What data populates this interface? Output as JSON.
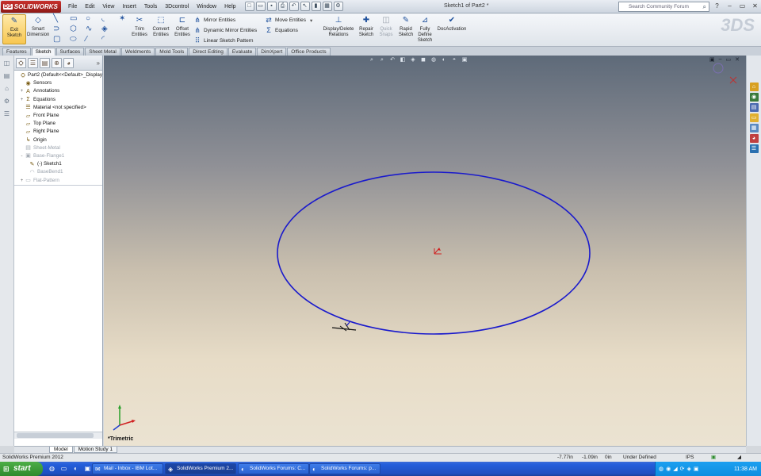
{
  "app": {
    "logo_text": "SOLIDWORKS",
    "logo_mark": "DS",
    "menus": [
      "File",
      "Edit",
      "View",
      "Insert",
      "Tools",
      "3Dcontrol",
      "Window",
      "Help"
    ],
    "window_title": "Sketch1 of Part2 *",
    "search_placeholder": "Search Community Forum"
  },
  "command_manager": {
    "exit_sketch": "Exit Sketch",
    "smart_dimension": "Smart Dimension",
    "trim_entities": "Trim Entities",
    "convert_entities": "Convert Entities",
    "offset_entities": "Offset Entities",
    "mirror_entities": "Mirror Entities",
    "dynamic_mirror": "Dynamic Mirror Entities",
    "linear_pattern": "Linear Sketch Pattern",
    "move_entities": "Move Entities",
    "equations": "Equations",
    "display_delete_relations": "Display/Delete Relations",
    "repair_sketch": "Repair Sketch",
    "quick_snaps": "Quick Snaps",
    "rapid_sketch": "Rapid Sketch",
    "fully_define": "Fully Define Sketch",
    "docactivation": "DocActivation",
    "tabs": [
      "Features",
      "Sketch",
      "Surfaces",
      "Sheet Metal",
      "Weldments",
      "Mold Tools",
      "Direct Editing",
      "Evaluate",
      "DimXpert",
      "Office Products"
    ],
    "active_tab": "Sketch"
  },
  "feature_tree": {
    "items": [
      {
        "label": "Part2  (Default<<Default>_Display",
        "exp": "",
        "icon": "⛭",
        "dim": false,
        "indent": 0
      },
      {
        "label": "Sensors",
        "exp": "",
        "icon": "◉",
        "dim": false,
        "indent": 1
      },
      {
        "label": "Annotations",
        "exp": "+",
        "icon": "A",
        "dim": false,
        "indent": 1
      },
      {
        "label": "Equations",
        "exp": "+",
        "icon": "Σ",
        "dim": false,
        "indent": 1
      },
      {
        "label": "Material <not specified>",
        "exp": "",
        "icon": "☰",
        "dim": false,
        "indent": 1
      },
      {
        "label": "Front Plane",
        "exp": "",
        "icon": "▱",
        "dim": false,
        "indent": 1
      },
      {
        "label": "Top Plane",
        "exp": "",
        "icon": "▱",
        "dim": false,
        "indent": 1
      },
      {
        "label": "Right Plane",
        "exp": "",
        "icon": "▱",
        "dim": false,
        "indent": 1
      },
      {
        "label": "Origin",
        "exp": "",
        "icon": "↳",
        "dim": false,
        "indent": 1
      },
      {
        "label": "Sheet-Metal",
        "exp": "",
        "icon": "▤",
        "dim": true,
        "indent": 1
      },
      {
        "label": "Base-Flange1",
        "exp": "-",
        "icon": "▣",
        "dim": true,
        "indent": 1
      },
      {
        "label": "(-) Sketch1",
        "exp": "",
        "icon": "✎",
        "dim": false,
        "indent": 2
      },
      {
        "label": "BaseBend1",
        "exp": "",
        "icon": "◠",
        "dim": true,
        "indent": 2
      },
      {
        "label": "Flat-Pattern",
        "exp": "+",
        "icon": "▭",
        "dim": true,
        "indent": 1
      }
    ]
  },
  "viewport": {
    "view_label": "*Trimetric",
    "sketch_color": "#1a1acc"
  },
  "model_tabs": [
    "Model",
    "Motion Study 1"
  ],
  "status": {
    "product": "SolidWorks Premium 2012",
    "x": "-7.77in",
    "y": "-1.09in",
    "z": "0in",
    "state": "Under Defined",
    "units": "IPS"
  },
  "taskbar": {
    "start": "start",
    "buttons": [
      {
        "label": "Mail - Inbox - IBM Lot...",
        "icon": "✉"
      },
      {
        "label": "SolidWorks Premium 2...",
        "icon": "◈"
      },
      {
        "label": "SolidWorks Forums: C...",
        "icon": "◐"
      },
      {
        "label": "SolidWorks Forums: p...",
        "icon": "◐"
      }
    ],
    "clock": "11:38 AM"
  }
}
